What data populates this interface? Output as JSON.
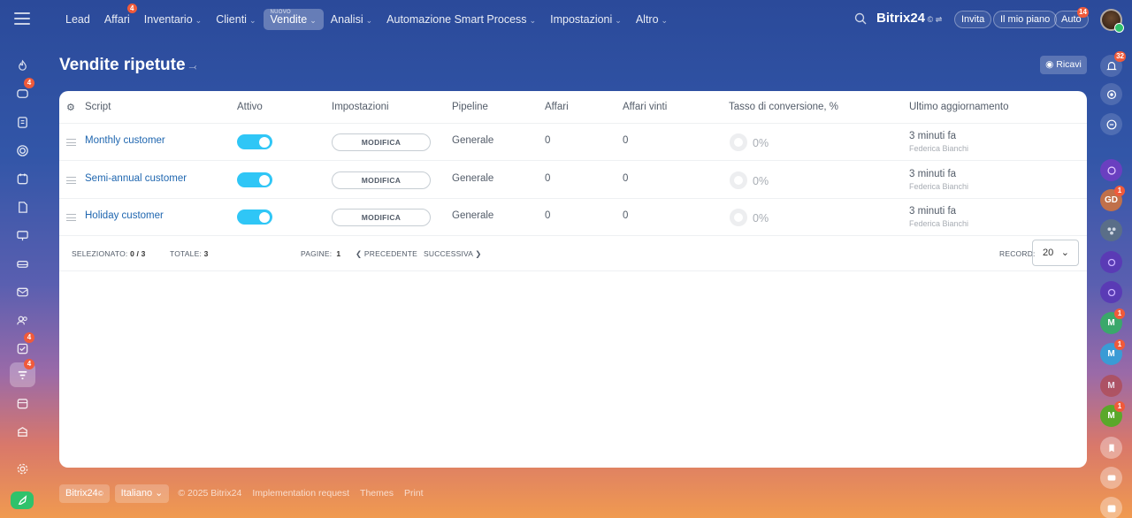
{
  "topnav": {
    "items": [
      {
        "label": "Lead",
        "chevron": false
      },
      {
        "label": "Affari",
        "chevron": false,
        "badge": "4"
      },
      {
        "label": "Inventario",
        "chevron": true
      },
      {
        "label": "Clienti",
        "chevron": true
      },
      {
        "label": "Vendite",
        "chevron": true,
        "active": true,
        "super": "NUOVO"
      },
      {
        "label": "Analisi",
        "chevron": true
      },
      {
        "label": "Automazione Smart Process",
        "chevron": true
      },
      {
        "label": "Impostazioni",
        "chevron": true
      },
      {
        "label": "Altro",
        "chevron": true
      }
    ],
    "brand": "Bitrix24",
    "brand_symbol": "©",
    "invite_label": "Invita",
    "plan_label": "Il mio piano",
    "auto_label": "Auto",
    "auto_badge": "14"
  },
  "left_sidebar": {
    "badges": {
      "chat": "4",
      "tasks": "4",
      "sales": "4"
    }
  },
  "right_sidebar": {
    "notifications_badge": "32",
    "avatars": [
      {
        "initials": "GD",
        "color": "#c0704a",
        "badge": "1"
      },
      {
        "initials": "M",
        "color": "#3aa86b",
        "badge": "1"
      },
      {
        "initials": "M",
        "color": "#3a9bd5",
        "badge": "1"
      },
      {
        "initials": "M",
        "color": "#b04a52",
        "badge": ""
      },
      {
        "initials": "M",
        "color": "#5aa82a",
        "badge": "1"
      }
    ]
  },
  "page": {
    "title": "Vendite ripetute",
    "ricavi_label": "Ricavi"
  },
  "table": {
    "columns": [
      "Script",
      "Attivo",
      "Impostazioni",
      "Pipeline",
      "Affari",
      "Affari vinti",
      "Tasso di conversione, %",
      "Ultimo aggiornamento"
    ],
    "rows": [
      {
        "script": "Monthly customer",
        "action": "MODIFICA",
        "pipeline": "Generale",
        "affari": "0",
        "affari_vinti": "0",
        "conversione": "0%",
        "aggiornamento": "3 minuti fa",
        "utente": "Federica Bianchi"
      },
      {
        "script": "Semi-annual customer",
        "action": "MODIFICA",
        "pipeline": "Generale",
        "affari": "0",
        "affari_vinti": "0",
        "conversione": "0%",
        "aggiornamento": "3 minuti fa",
        "utente": "Federica Bianchi"
      },
      {
        "script": "Holiday customer",
        "action": "MODIFICA",
        "pipeline": "Generale",
        "affari": "0",
        "affari_vinti": "0",
        "conversione": "0%",
        "aggiornamento": "3 minuti fa",
        "utente": "Federica Bianchi"
      }
    ],
    "footer": {
      "selected_label": "SELEZIONATO:",
      "selected_value": "0 / 3",
      "total_label": "TOTALE:",
      "total_value": "3",
      "pages_label": "PAGINE:",
      "pages_value": "1",
      "prev_label": "PRECEDENTE",
      "next_label": "SUCCESSIVA",
      "records_label": "RECORD:",
      "records_value": "20"
    }
  },
  "page_footer": {
    "brand": "Bitrix24",
    "brand_symbol": "©",
    "language": "Italiano",
    "copyright": "© 2025 Bitrix24",
    "links": [
      "Implementation request",
      "Themes",
      "Print"
    ]
  }
}
